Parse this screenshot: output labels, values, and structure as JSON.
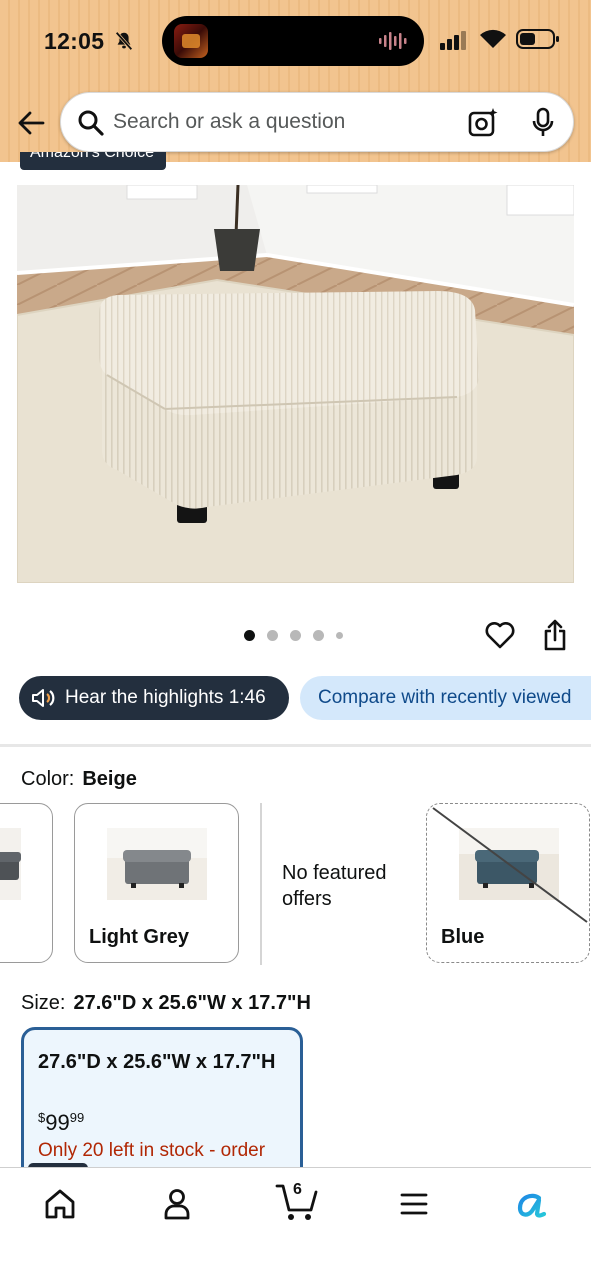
{
  "status_bar": {
    "time": "12:05"
  },
  "search": {
    "placeholder": "Search or ask a question"
  },
  "badge": {
    "label": "Amazon's Choice"
  },
  "carousel": {
    "image_count": 5,
    "active_index": 0
  },
  "actions": {
    "hear_label": "Hear the highlights 1:46",
    "compare_label": "Compare with recently viewed"
  },
  "color": {
    "label": "Color:",
    "selected": "Beige",
    "options": [
      {
        "name": "Light Grey"
      },
      {
        "name": "Blue",
        "unavailable": true
      }
    ],
    "no_offers_text": "No featured offers"
  },
  "size": {
    "label": "Size:",
    "selected": "27.6\"D x 25.6\"W x 17.7\"H",
    "card": {
      "title": "27.6\"D x 25.6\"W x 17.7\"H",
      "price_symbol": "$",
      "price_whole": "99",
      "price_fraction": "99",
      "stock_text": "Only 20 left in stock - order"
    }
  },
  "bottom_nav": {
    "cart_count": "6",
    "items": [
      "home-icon",
      "account-icon",
      "cart-icon",
      "menu-icon",
      "rufus-icon"
    ]
  },
  "colors": {
    "header_bg": "#f2c48f",
    "dark_navy": "#232f3e",
    "compare_bg": "#d4e8fb",
    "selected_border": "#2a5f96",
    "stock_red": "#b12704"
  }
}
